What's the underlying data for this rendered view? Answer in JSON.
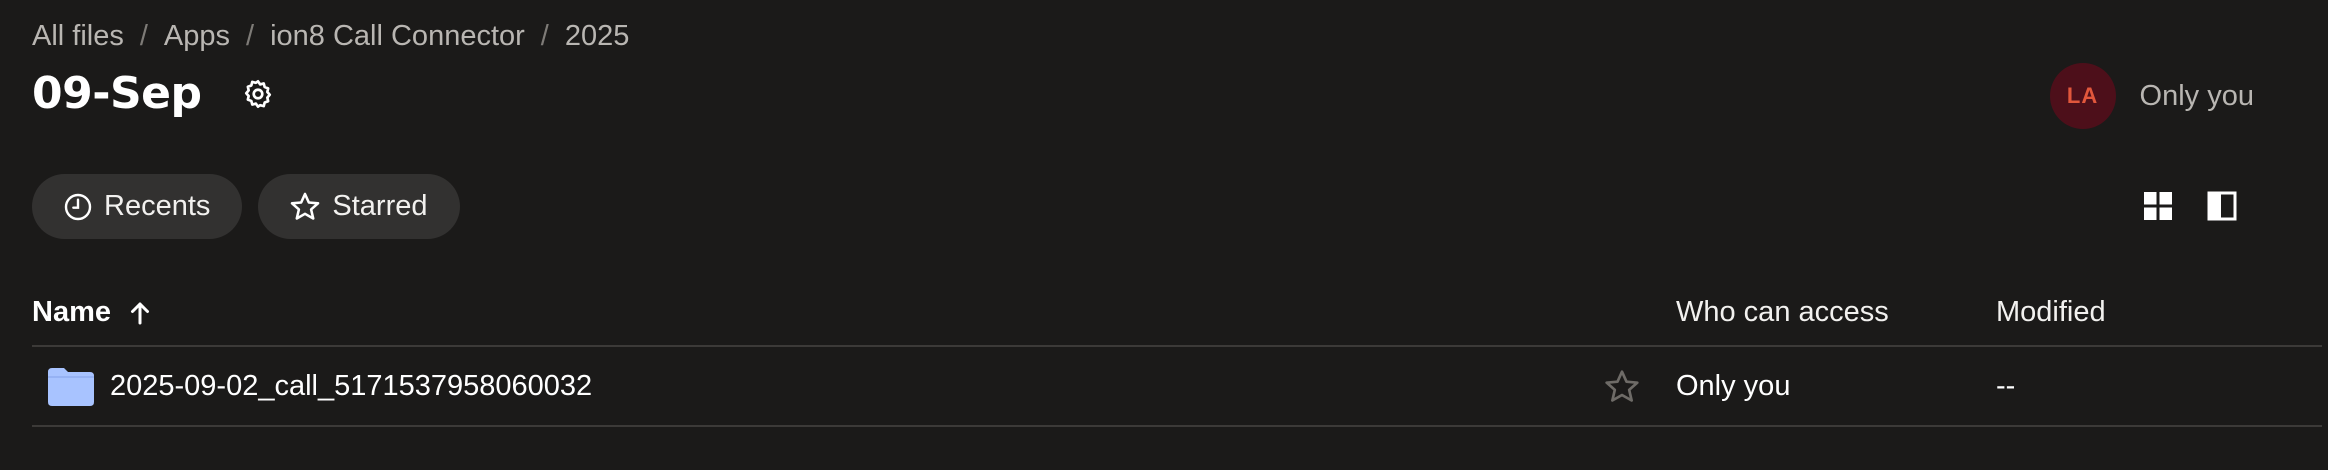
{
  "breadcrumb": [
    "All files",
    "Apps",
    "ion8 Call Connector",
    "2025"
  ],
  "breadcrumb_separator": "/",
  "title": "09-Sep",
  "share": {
    "avatar_initials": "LA",
    "label": "Only you"
  },
  "filters": {
    "recents": "Recents",
    "starred": "Starred"
  },
  "table": {
    "columns": {
      "name": "Name",
      "access": "Who can access",
      "modified": "Modified"
    },
    "sort": "ascending",
    "rows": [
      {
        "name": "2025-09-02_call_5171537958060032",
        "access": "Only you",
        "modified": "--",
        "type": "folder",
        "starred": false
      }
    ]
  },
  "colors": {
    "background": "#1b1a19",
    "folder": "#a8c3ff",
    "avatar_bg": "#4d0f1a",
    "avatar_text": "#e1573c"
  }
}
